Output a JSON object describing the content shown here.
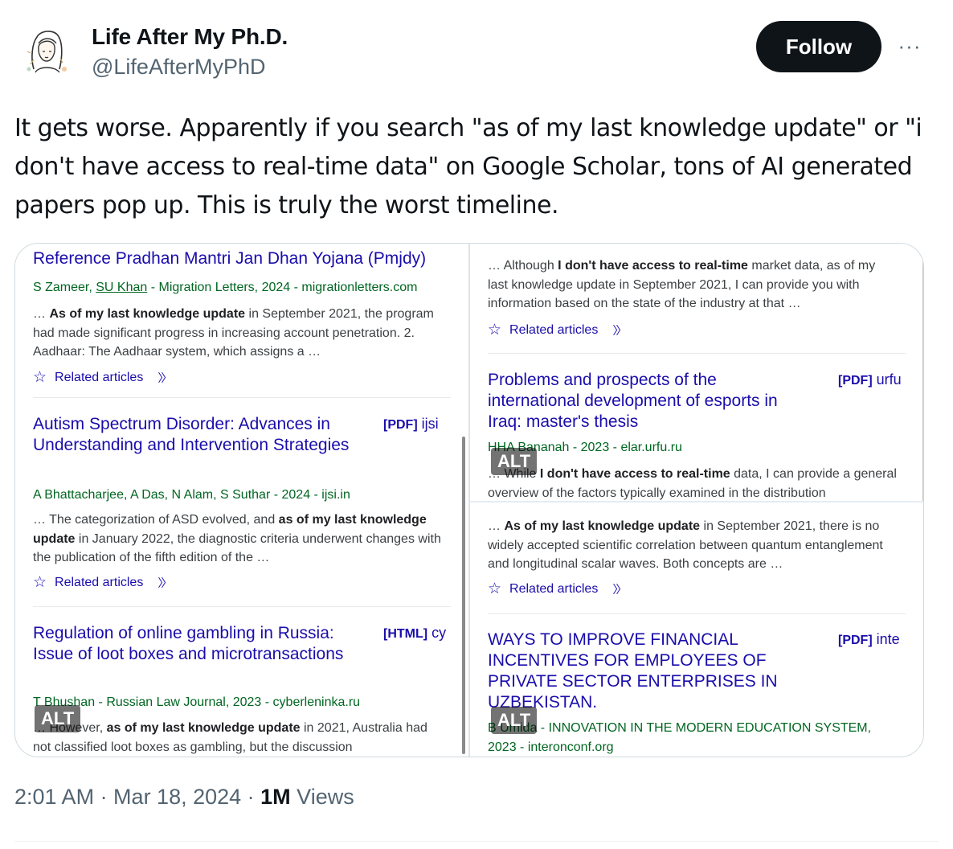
{
  "author": {
    "name": "Life After My Ph.D.",
    "handle": "@LifeAfterMyPhD",
    "avatar_icon": "illustrated-woman-portrait"
  },
  "follow_label": "Follow",
  "more_label": "···",
  "tweet_text": "It gets worse. Apparently if you search \"as of my last knowledge update\" or \"i don't have access to real-time data\" on Google Scholar, tons of AI generated papers pop up. This is truly the worst timeline.",
  "related_label": "Related articles",
  "alt_label": "ALT",
  "images": {
    "left": {
      "results": [
        {
          "title": "Reference Pradhan Mantri Jan Dhan Yojana (Pmjdy)",
          "meta_authors": "S Zameer, ",
          "meta_author_link": "SU Khan",
          "meta_rest": " - Migration Letters, 2024 - migrationletters.com",
          "snippet_pre": "… ",
          "snippet_bold": "As of my last knowledge update",
          "snippet_post": " in September 2021, the program had made significant progress in increasing account penetration. 2. Aadhaar: The Aadhaar system, which assigns a …"
        },
        {
          "title": "Autism Spectrum Disorder: Advances in Understanding and Intervention Strategies",
          "pdf_tag": "[PDF]",
          "pdf_site": " ijsi",
          "meta": "A Bhattacharjee, A Das, N Alam, S Suthar - 2024 - ijsi.in",
          "snippet_pre": "… The categorization of ASD evolved, and ",
          "snippet_bold": "as of my last knowledge update",
          "snippet_post": " in January 2022, the diagnostic criteria underwent changes with the publication of the fifth edition of the …"
        },
        {
          "title": "Regulation of online gambling in Russia: Issue of loot boxes and microtransactions",
          "pdf_tag": "[HTML]",
          "pdf_site": " cy",
          "meta": "T Bhushan - Russian Law Journal, 2023 - cyberleninka.ru",
          "snippet_pre": "… However, ",
          "snippet_bold": "as of my last knowledge update",
          "snippet_post": " in 2021, Australia had not classified loot boxes as gambling, but the discussion"
        }
      ]
    },
    "right_top": {
      "results": [
        {
          "snippet_pre": "… Although ",
          "snippet_bold": "I don't have access to real-time",
          "snippet_post": " market data, as of my last knowledge update in September 2021, I can provide you with information based on the state of the industry at that …"
        },
        {
          "title": "Problems and prospects of the international development of esports in Iraq: master's thesis",
          "pdf_tag": "[PDF]",
          "pdf_site": " urfu",
          "meta": "HHA Bananah - 2023 - elar.urfu.ru",
          "snippet_pre": "… While ",
          "snippet_bold": "I don't have access to real-time",
          "snippet_post": " data, I can provide a general overview of the factors typically examined in the distribution"
        }
      ]
    },
    "right_bottom": {
      "results": [
        {
          "snippet_pre": "… ",
          "snippet_bold": "As of my last knowledge update",
          "snippet_post": " in September 2021, there is no widely accepted scientific correlation between quantum entanglement and longitudinal scalar waves. Both concepts are …"
        },
        {
          "title": "WAYS TO IMPROVE FINANCIAL INCENTIVES FOR EMPLOYEES OF PRIVATE SECTOR ENTERPRISES IN UZBEKISTAN.",
          "pdf_tag": "[PDF]",
          "pdf_site": " inte",
          "meta_line1": "B Umida - INNOVATION IN THE MODERN EDUCATION SYSTEM,",
          "meta_line2": "2023 - interonconf.org"
        }
      ]
    }
  },
  "timestamp": {
    "time_date": "2:01 AM · Mar 18, 2024 · ",
    "views_count": "1M",
    "views_label": " Views"
  },
  "colors": {
    "follow_bg": "#0f1419",
    "scholar_title": "#1a0dab",
    "scholar_meta": "#006621",
    "secondary_text": "#536471"
  }
}
